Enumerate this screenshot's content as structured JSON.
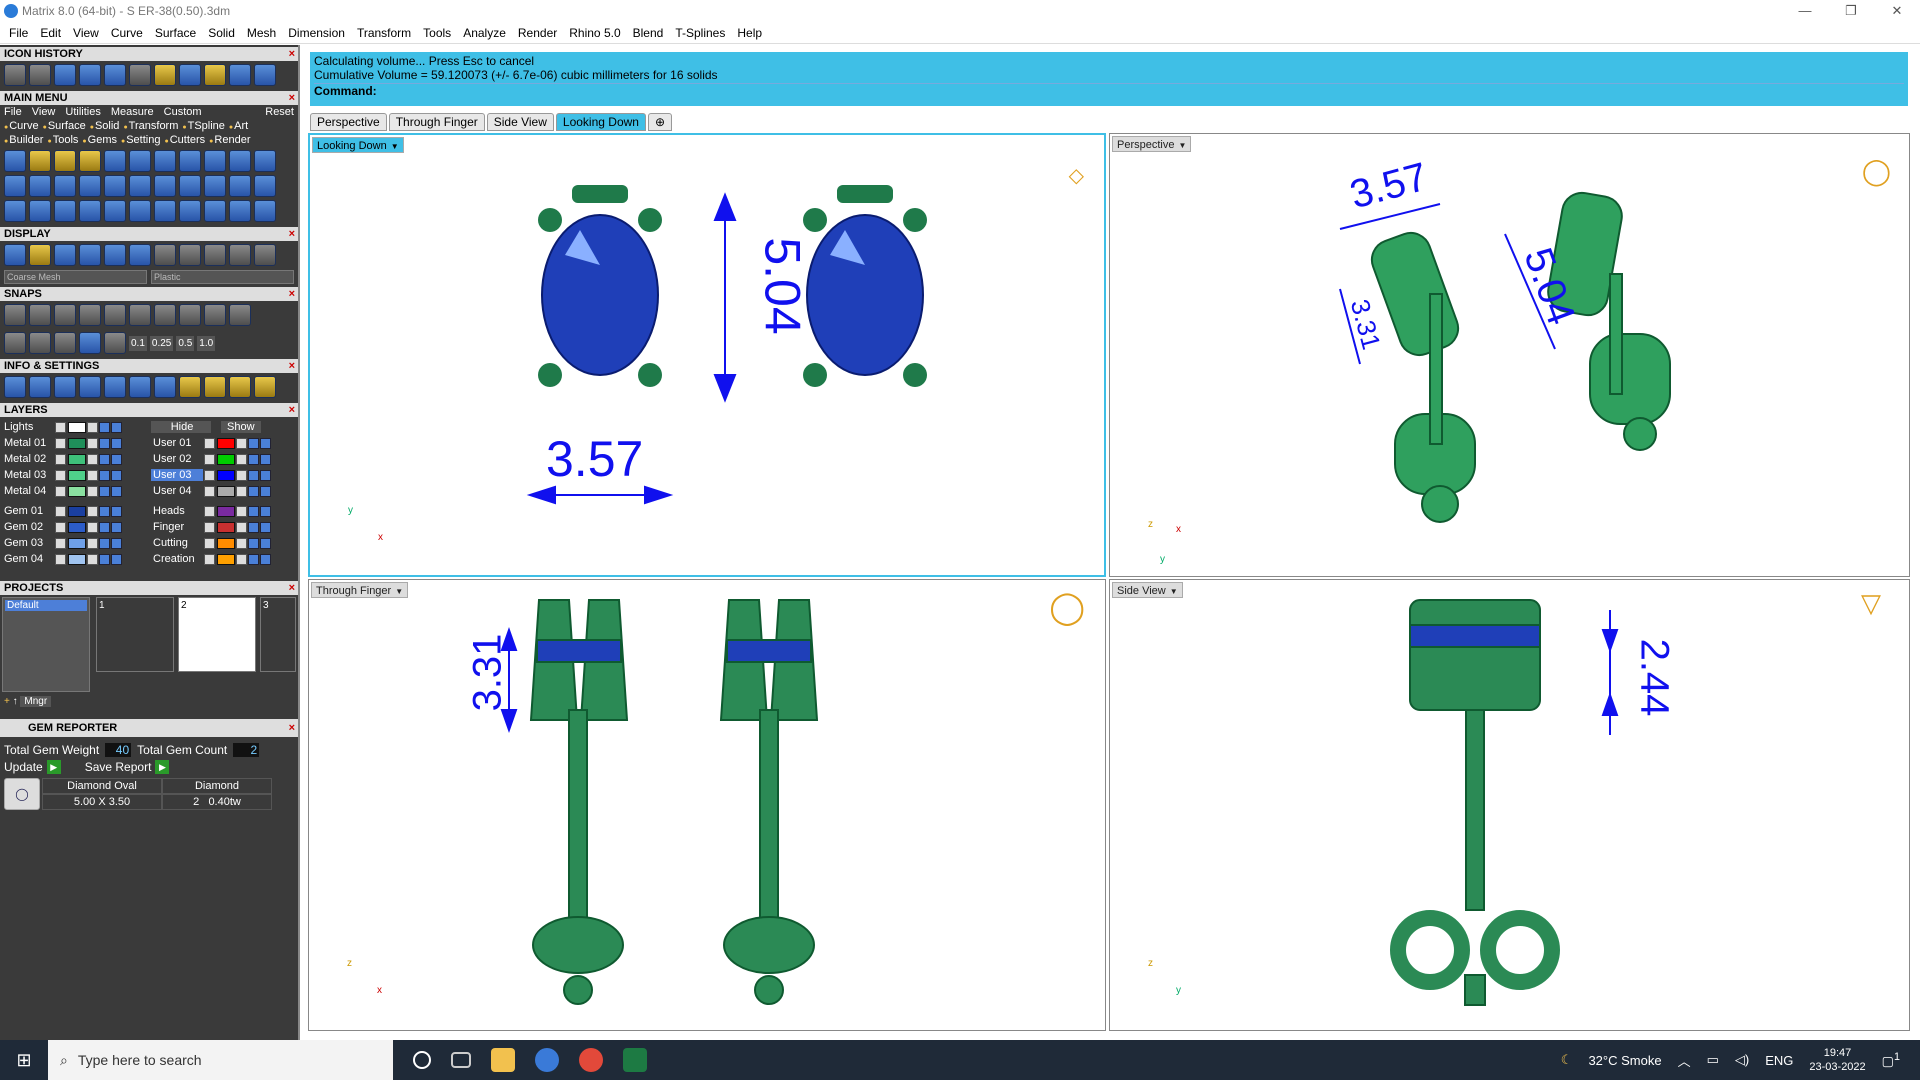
{
  "window": {
    "title": "Matrix 8.0 (64-bit) - S ER-38(0.50).3dm",
    "controls": [
      "—",
      "❐",
      "✕"
    ]
  },
  "menu": [
    "File",
    "Edit",
    "View",
    "Curve",
    "Surface",
    "Solid",
    "Mesh",
    "Dimension",
    "Transform",
    "Tools",
    "Analyze",
    "Render",
    "Rhino 5.0",
    "Blend",
    "T-Splines",
    "Help"
  ],
  "panels": {
    "icon_history": "ICON HISTORY",
    "main_menu": "MAIN MENU",
    "main_menu_items": [
      "File",
      "View",
      "Utilities",
      "Measure",
      "Custom"
    ],
    "reset": "Reset",
    "categories_row1": [
      "Curve",
      "Surface",
      "Solid",
      "Transform",
      "TSpline",
      "Art"
    ],
    "categories_row2": [
      "Builder",
      "Tools",
      "Gems",
      "Setting",
      "Cutters",
      "Render"
    ],
    "display": "DISPLAY",
    "display_mesh": "Coarse Mesh",
    "display_material": "Plastic",
    "snaps": "SNAPS",
    "snap_values": [
      "0.1",
      "0.25",
      "0.5",
      "1.0"
    ],
    "info": "INFO & SETTINGS",
    "layers": "LAYERS",
    "projects": "PROJECTS",
    "gem_reporter": "GEM REPORTER"
  },
  "layers": {
    "left": [
      {
        "name": "Lights",
        "color": "#ffffff"
      },
      {
        "name": "Metal 01",
        "color": "#1f8f5a"
      },
      {
        "name": "Metal 02",
        "color": "#3ec07a"
      },
      {
        "name": "Metal 03",
        "color": "#4fd08a"
      },
      {
        "name": "Metal 04",
        "color": "#8ae0a0"
      },
      {
        "name": "Gem 01",
        "color": "#1a3fa0"
      },
      {
        "name": "Gem 02",
        "color": "#2c5cc8"
      },
      {
        "name": "Gem 03",
        "color": "#6fa0e8"
      },
      {
        "name": "Gem 04",
        "color": "#a0c4f0"
      }
    ],
    "right": [
      {
        "name": "Hide",
        "color": ""
      },
      {
        "name": "User 01",
        "color": "#ff0000"
      },
      {
        "name": "User 02",
        "color": "#00cc00"
      },
      {
        "name": "User 03",
        "color": "#0000ff"
      },
      {
        "name": "User 04",
        "color": "#aaaaaa"
      },
      {
        "name": "Heads",
        "color": "#7a2aa0"
      },
      {
        "name": "Finger",
        "color": "#c83030"
      },
      {
        "name": "Cutting",
        "color": "#ff8c00"
      },
      {
        "name": "Creation",
        "color": "#ffa000"
      }
    ],
    "show": "Show"
  },
  "projects": {
    "list": "Default",
    "thumbs": [
      "1",
      "2",
      "3"
    ],
    "mngr": "Mngr"
  },
  "gem_reporter": {
    "total_weight_label": "Total Gem Weight",
    "total_weight": "40",
    "total_count_label": "Total Gem Count",
    "total_count": "2",
    "update": "Update",
    "save_report": "Save Report",
    "col1_head": "Diamond Oval",
    "col1_val": "5.00 X 3.50",
    "col2_head": "Diamond",
    "col2_count": "2",
    "col2_val": "0.40tw"
  },
  "command": {
    "line1": "Calculating volume... Press Esc to cancel",
    "line2": "Cumulative Volume = 59.120073 (+/- 6.7e-06) cubic millimeters for 16 solids",
    "label": "Command:"
  },
  "tabs": [
    "Perspective",
    "Through Finger",
    "Side View",
    "Looking Down",
    "⊕"
  ],
  "viewports": {
    "top_left": {
      "label": "Looking Down",
      "dim_h": "5.04",
      "dim_w": "3.57",
      "ax1": "y",
      "ax2": "x"
    },
    "top_right": {
      "label": "Perspective",
      "dim_a": "3.57",
      "dim_b": "5.04",
      "dim_c": "3.31",
      "ax1": "z",
      "ax2": "x",
      "ax3": "y"
    },
    "bottom_left": {
      "label": "Through Finger",
      "dim": "3.31",
      "ax1": "z",
      "ax2": "x"
    },
    "bottom_right": {
      "label": "Side View",
      "dim": "2.44",
      "ax1": "z",
      "ax2": "y"
    }
  },
  "taskbar": {
    "search": "Type here to search",
    "weather": "32°C  Smoke",
    "lang": "ENG",
    "time": "19:47",
    "date": "23-03-2022",
    "notif": "1"
  }
}
